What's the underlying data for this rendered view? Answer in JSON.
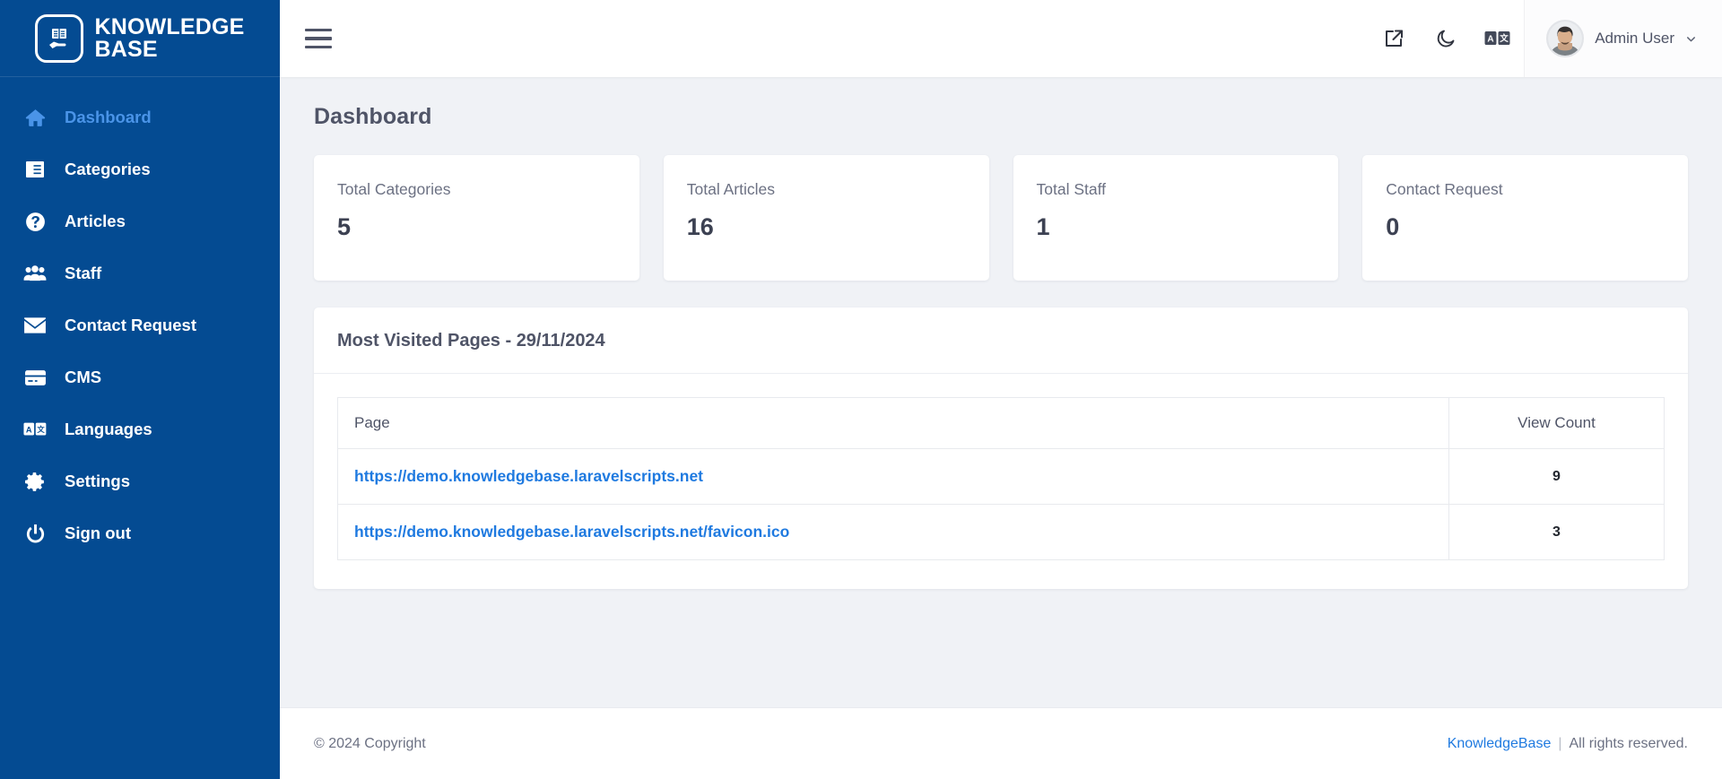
{
  "brand": {
    "line1": "KNOWLEDGE",
    "line2": "BASE",
    "logo_icon": "book-hand-icon",
    "accent_color": "#044b92"
  },
  "sidebar": {
    "items": [
      {
        "label": "Dashboard",
        "icon": "home-icon",
        "active": true
      },
      {
        "label": "Categories",
        "icon": "list-box-icon",
        "active": false
      },
      {
        "label": "Articles",
        "icon": "question-circle-icon",
        "active": false
      },
      {
        "label": "Staff",
        "icon": "users-icon",
        "active": false
      },
      {
        "label": "Contact Request",
        "icon": "envelope-icon",
        "active": false
      },
      {
        "label": "CMS",
        "icon": "card-icon",
        "active": false
      },
      {
        "label": "Languages",
        "icon": "translate-icon",
        "active": false
      },
      {
        "label": "Settings",
        "icon": "gear-icon",
        "active": false
      },
      {
        "label": "Sign out",
        "icon": "power-icon",
        "active": false
      }
    ],
    "active_color": "#4a94e8"
  },
  "navbar": {
    "menu_toggle_icon": "hamburger-icon",
    "actions": [
      {
        "icon": "external-link-icon",
        "name": "visit-site-button"
      },
      {
        "icon": "moon-icon",
        "name": "dark-mode-toggle"
      },
      {
        "icon": "translate-icon",
        "name": "language-switcher"
      }
    ],
    "user": {
      "name": "Admin User",
      "avatar_icon": "user-avatar",
      "caret_icon": "chevron-down-icon"
    }
  },
  "page": {
    "title": "Dashboard"
  },
  "stats": [
    {
      "label": "Total Categories",
      "value": "5"
    },
    {
      "label": "Total Articles",
      "value": "16"
    },
    {
      "label": "Total Staff",
      "value": "1"
    },
    {
      "label": "Contact Request",
      "value": "0"
    }
  ],
  "most_visited": {
    "title": "Most Visited Pages - 29/11/2024",
    "columns": {
      "page": "Page",
      "count": "View Count"
    },
    "rows": [
      {
        "page": "https://demo.knowledgebase.laravelscripts.net",
        "count": "9"
      },
      {
        "page": "https://demo.knowledgebase.laravelscripts.net/favicon.ico",
        "count": "3"
      }
    ]
  },
  "footer": {
    "copyright": "© 2024 Copyright",
    "brand_link": "KnowledgeBase",
    "separator": "|",
    "rights": "All rights reserved."
  }
}
